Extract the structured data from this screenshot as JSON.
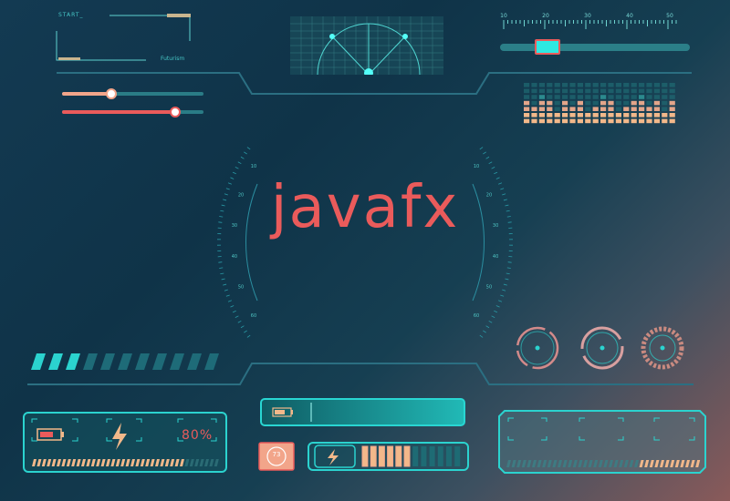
{
  "labels": {
    "start": "START_",
    "futurism": "Futurism"
  },
  "title": "javafx",
  "ruler": {
    "ticks": [
      "10",
      "20",
      "30",
      "40",
      "50"
    ]
  },
  "battery": {
    "percent_label": "80%",
    "level": 0.8
  },
  "badge": {
    "value": "73"
  },
  "sliders": {
    "top_position": 0.25,
    "slider1": 0.35,
    "slider2": 0.8
  },
  "dial_labels": {
    "left": [
      "60",
      "50",
      "40",
      "30",
      "20",
      "10"
    ],
    "right": [
      "10",
      "20",
      "30",
      "40",
      "50",
      "60"
    ]
  },
  "colors": {
    "accent": "#2bd3cf",
    "warning": "#ea5b5b",
    "amber": "#f2b88a"
  }
}
